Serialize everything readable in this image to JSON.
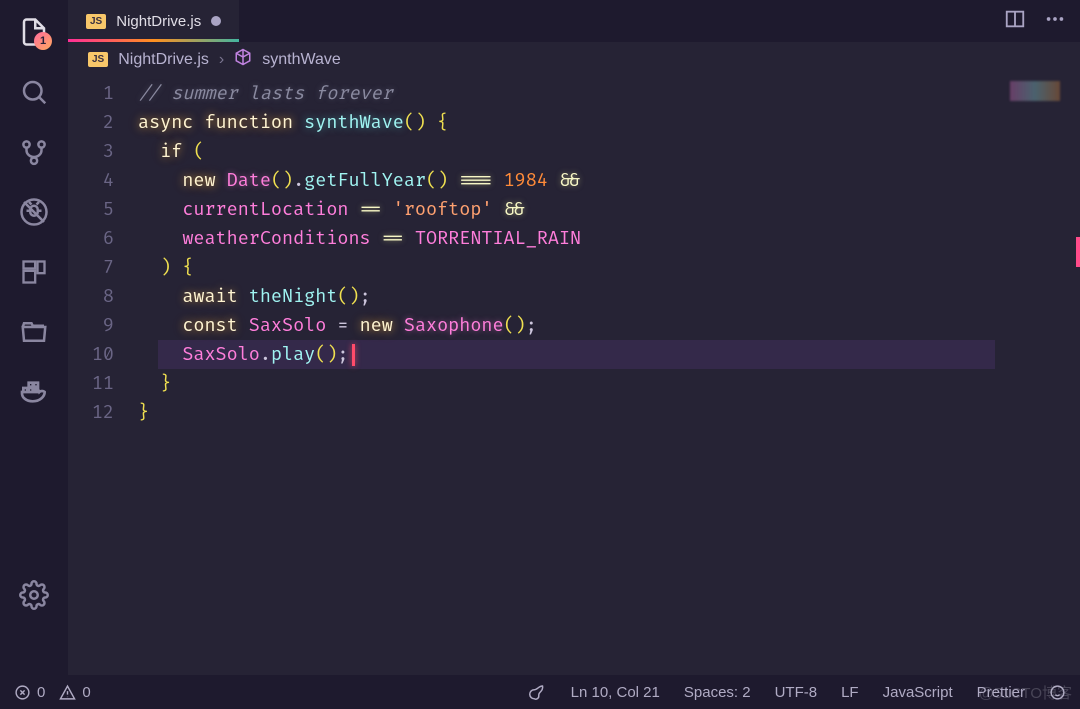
{
  "activity_bar": {
    "badge": "1"
  },
  "tab": {
    "language_badge": "JS",
    "title": "NightDrive.js"
  },
  "breadcrumb": {
    "language_badge": "JS",
    "file": "NightDrive.js",
    "symbol": "synthWave"
  },
  "code": {
    "line_numbers": [
      "1",
      "2",
      "3",
      "4",
      "5",
      "6",
      "7",
      "8",
      "9",
      "10",
      "11",
      "12"
    ],
    "line1_comment": "// summer lasts forever",
    "kw_async": "async",
    "kw_function": "function",
    "fn_name": "synthWave",
    "kw_if": "if",
    "kw_new": "new",
    "cls_date": "Date",
    "call_getFullYear": "getFullYear",
    "op_eq3": "===",
    "lit_1984": "1984",
    "op_and": "&&",
    "var_currentLocation": "currentLocation",
    "op_eq2": "==",
    "str_rooftop": "'rooftop'",
    "var_weatherConditions": "weatherConditions",
    "const_torrential": "TORRENTIAL_RAIN",
    "kw_await": "await",
    "call_theNight": "theNight",
    "kw_const": "const",
    "var_saxsolo": "SaxSolo",
    "cls_saxophone": "Saxophone",
    "call_play": "play"
  },
  "status": {
    "errors": "0",
    "warnings": "0",
    "cursor": "Ln 10, Col 21",
    "spaces": "Spaces: 2",
    "encoding": "UTF-8",
    "eol": "LF",
    "language": "JavaScript",
    "formatter": "Prettier"
  },
  "watermark": "@51CTO博客"
}
